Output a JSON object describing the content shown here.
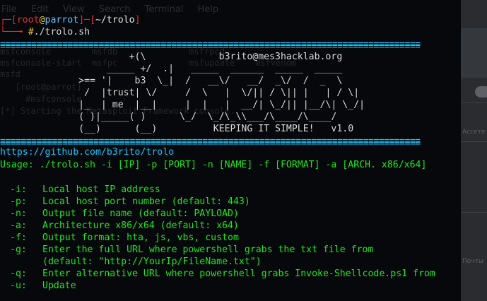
{
  "ghost": {
    "menu": [
      "File",
      "Edit",
      "View",
      "Search",
      "Terminal",
      "Help"
    ],
    "lines": [
      "msfconsole        msfdb              msfrpcd",
      "msfconsole-start  msfpc              msfupdate    msfvenom",
      "msfd",
      "   [root@parrot]",
      "     #msfconsole",
      "[*] Starting the Metasploit Framework console..."
    ],
    "right_text": [
      "Ассете",
      "Почты"
    ]
  },
  "prompt": {
    "open_bracket": "┌─[",
    "user": "root",
    "at": "@",
    "host": "parrot",
    "mid": "]─[",
    "path": "~/trolo",
    "close": "]",
    "cmd_prefix": "└──╼ ",
    "hash": "#",
    "command": "./trolo.sh"
  },
  "separator": "=================================================================================",
  "banner": {
    "art": [
      "                       +(\\             b3rito@mes3hacklab.org",
      "                   _____ +/  .|   _____  ______  _____  _____",
      "              >== '|    b3  \\_|  /   __\\/   __/  _\\/  /  _  \\",
      "               /  |trust| \\/     /  \\   |  \\/|| / \\|| |   | / \\|",
      "              |_  | me  |__|     |  |   |  __/| \\_/|| |__/\\| \\_/|",
      "              ( )|_____( )      \\_/  \\_/\\_\\\\___/\\____/\\____/",
      "              (__)      (__)          KEEPING IT SIMPLE!   v1.0"
    ],
    "email": "b3rito@mes3hacklab.org",
    "motto": "KEEPING IT SIMPLE!",
    "version": "v1.0"
  },
  "url": "https://github.com/b3rito/trolo",
  "usage": "Usage: ./trolo.sh -i [IP] -p [PORT] -n [NAME] -f [FORMAT] -a [ARCH. x86/x64]",
  "options": [
    {
      "flag": "-i:",
      "desc": "Local host IP address"
    },
    {
      "flag": "-p:",
      "desc": "Local host port number (default: 443)"
    },
    {
      "flag": "-n:",
      "desc": "Output file name (default: PAYLOAD)"
    },
    {
      "flag": "-a:",
      "desc": "Architecture x86/x64 (default: x64)"
    },
    {
      "flag": "-f:",
      "desc": "Output format: hta, js, vbs, custom"
    },
    {
      "flag": "-g:",
      "desc": "Enter the full URL where powershell grabs the txt file from"
    },
    {
      "flag": "",
      "desc": "(default: \"http://YourIp/FileName.txt\")"
    },
    {
      "flag": "-q:",
      "desc": "Enter alternative URL where powershell grabs Invoke-Shellcode.ps1 from"
    },
    {
      "flag": "-u:",
      "desc": "Update"
    }
  ],
  "colors": {
    "background": "#07080b",
    "prompt_red": "#e0312e",
    "separator_cyan": "#18c8ff",
    "option_green": "#1ee61e",
    "art_white": "#d9d9d9"
  }
}
